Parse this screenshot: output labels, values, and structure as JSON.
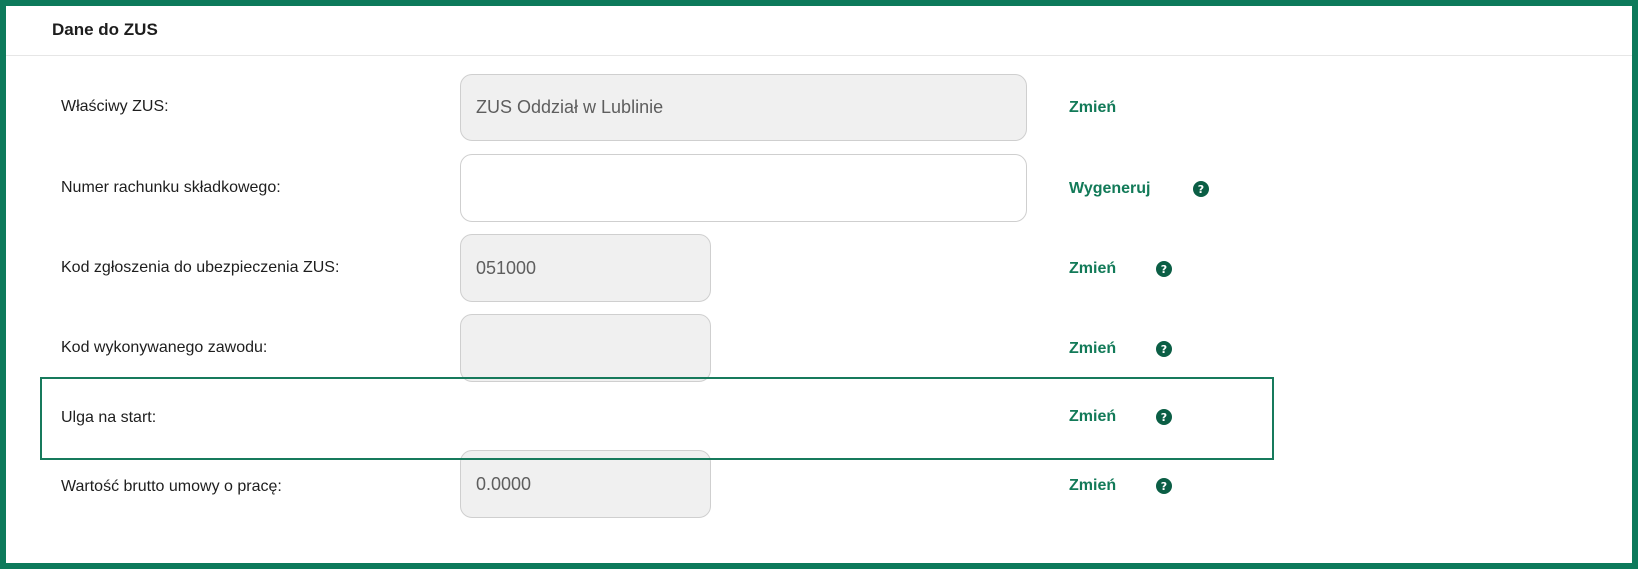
{
  "section": {
    "title": "Dane do ZUS"
  },
  "rows": [
    {
      "label": "Właściwy ZUS:",
      "value": "ZUS Oddział w Lublinie",
      "action": "Zmień"
    },
    {
      "label": "Numer rachunku składkowego:",
      "value": "",
      "action": "Wygeneruj",
      "help_icon": "question-circle-icon"
    },
    {
      "label": "Kod zgłoszenia do ubezpieczenia ZUS:",
      "value": "051000",
      "action": "Zmień",
      "help_icon": "question-circle-icon"
    },
    {
      "label": "Kod wykonywanego zawodu:",
      "value": "",
      "action": "Zmień",
      "help_icon": "question-circle-icon"
    },
    {
      "label": "Ulga na start:",
      "action": "Zmień",
      "help_icon": "question-circle-icon"
    },
    {
      "label": "Wartość brutto umowy o pracę:",
      "value": "0.0000",
      "action": "Zmień",
      "help_icon": "question-circle-icon"
    }
  ],
  "help_glyph": "?",
  "colors": {
    "frame_border": "#0d7a5b",
    "link_green": "#127a58",
    "help_icon_bg": "#0b5e45",
    "field_bg_disabled": "#f0f0f0",
    "field_border": "#cfcfcf",
    "highlight_border": "#177a5c"
  }
}
